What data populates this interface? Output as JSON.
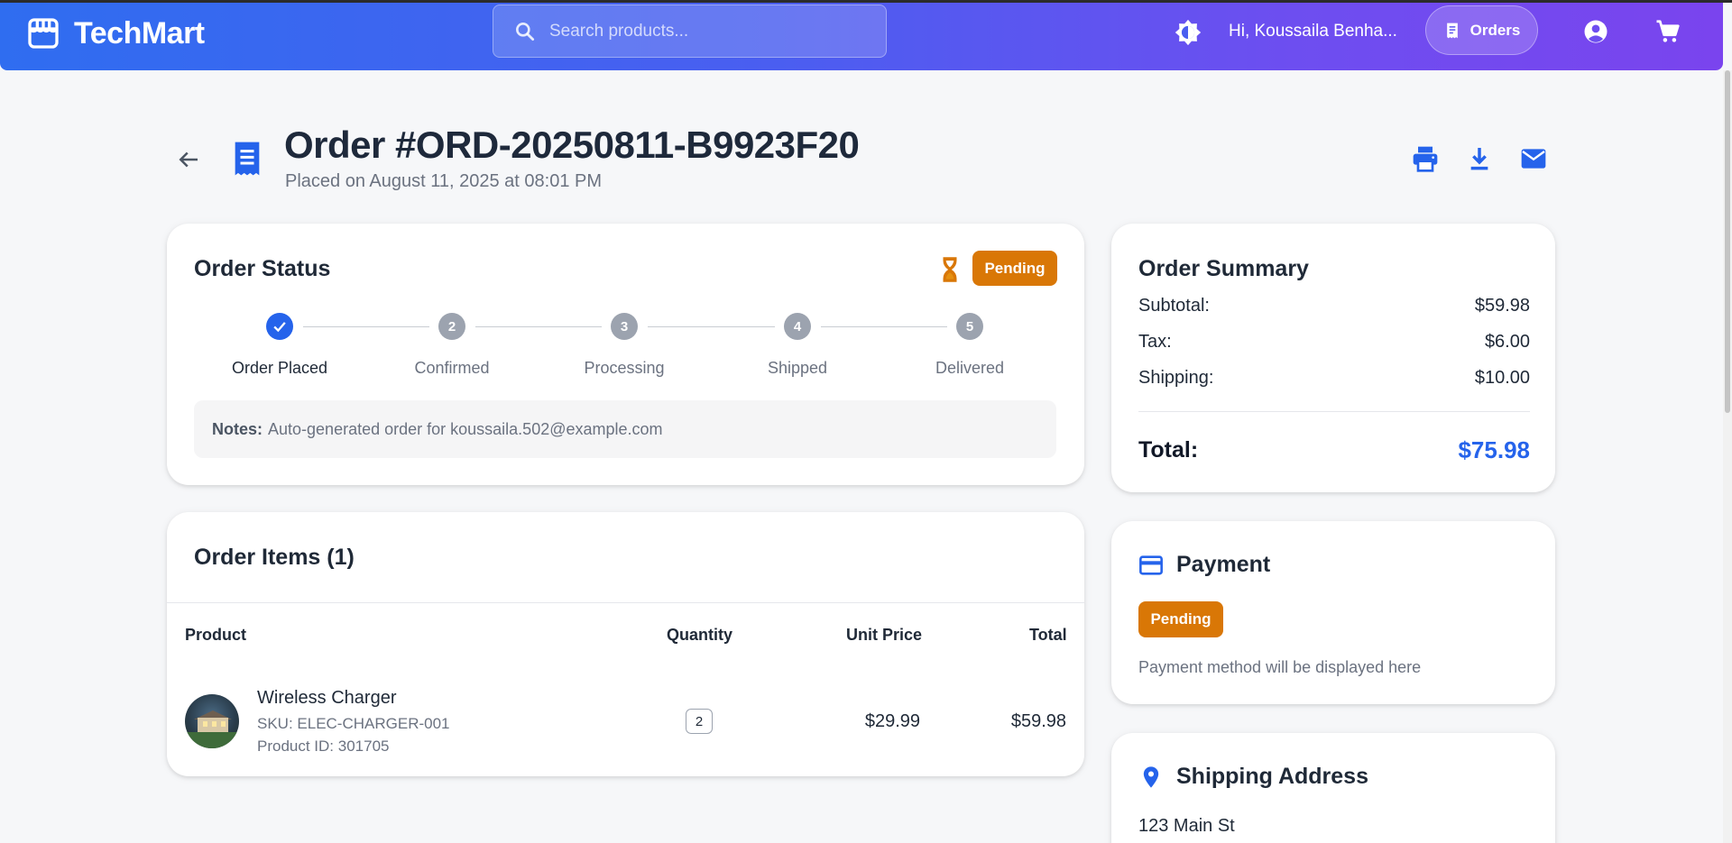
{
  "app": {
    "name": "TechMart",
    "search_placeholder": "Search products...",
    "greeting": "Hi, Koussaila Benha...",
    "orders_label": "Orders",
    "icons": [
      "storefront-icon",
      "search-icon",
      "theme-toggle-icon",
      "receipt-icon",
      "account-icon",
      "cart-icon"
    ]
  },
  "order": {
    "title": "Order #ORD-20250811-B9923F20",
    "placed_on": "Placed on August 11, 2025 at 08:01 PM",
    "actions": [
      "print-icon",
      "download-icon",
      "email-icon"
    ]
  },
  "status": {
    "title": "Order Status",
    "badge": "Pending",
    "steps": [
      {
        "num": "1",
        "label": "Order Placed",
        "done": true
      },
      {
        "num": "2",
        "label": "Confirmed",
        "done": false
      },
      {
        "num": "3",
        "label": "Processing",
        "done": false
      },
      {
        "num": "4",
        "label": "Shipped",
        "done": false
      },
      {
        "num": "5",
        "label": "Delivered",
        "done": false
      }
    ],
    "notes_label": "Notes:",
    "notes_text": "Auto-generated order for koussaila.502@example.com"
  },
  "items": {
    "title": "Order Items (1)",
    "headers": {
      "product": "Product",
      "quantity": "Quantity",
      "unit_price": "Unit Price",
      "total": "Total"
    },
    "rows": [
      {
        "name": "Wireless Charger",
        "sku": "SKU: ELEC-CHARGER-001",
        "product_id": "Product ID: 301705",
        "quantity": "2",
        "unit_price": "$29.99",
        "total": "$59.98"
      }
    ]
  },
  "summary": {
    "title": "Order Summary",
    "subtotal_label": "Subtotal:",
    "subtotal": "$59.98",
    "tax_label": "Tax:",
    "tax": "$6.00",
    "shipping_label": "Shipping:",
    "shipping": "$10.00",
    "total_label": "Total:",
    "total": "$75.98"
  },
  "payment": {
    "title": "Payment",
    "badge": "Pending",
    "note": "Payment method will be displayed here"
  },
  "shipping": {
    "title": "Shipping Address",
    "line1": "123 Main St"
  },
  "colors": {
    "primary": "#2563eb",
    "pending": "#d97706",
    "appbar_start": "#2f6df0",
    "appbar_end": "#7a44ee"
  }
}
